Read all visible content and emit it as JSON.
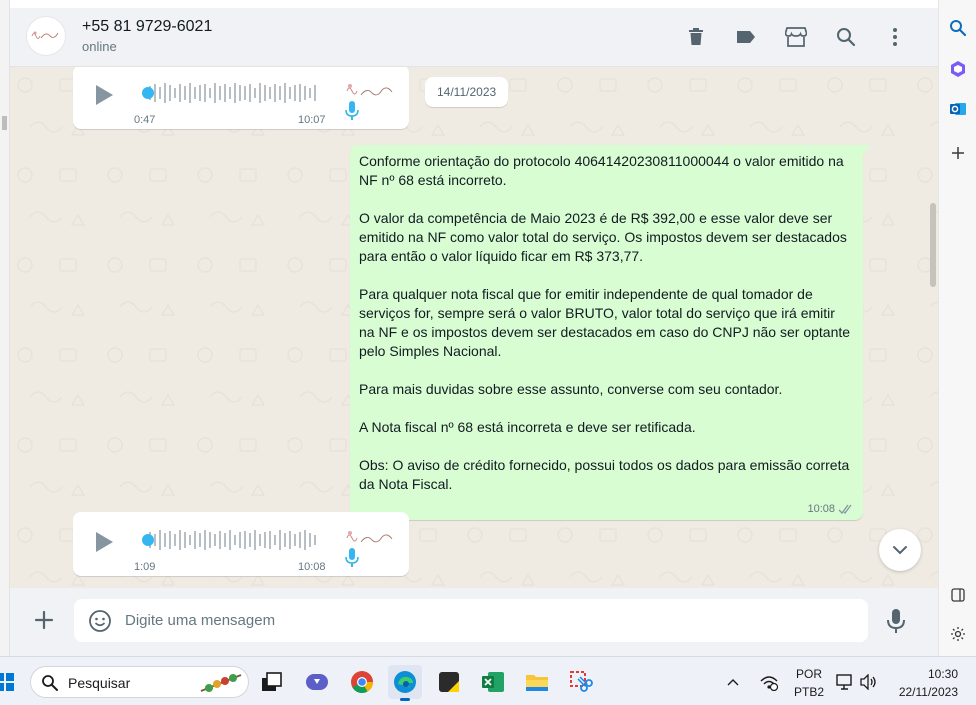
{
  "chat": {
    "contact_name": "+55 81 9729-6021",
    "status": "online"
  },
  "voice_notes": [
    {
      "duration": "0:47",
      "time": "10:07"
    },
    {
      "duration": "1:09",
      "time": "10:08"
    }
  ],
  "date_chip": "14/11/2023",
  "outgoing_message": {
    "paragraphs": [
      "Conforme orientação do protocolo 40641420230811000044 o valor emitido na NF nº 68 está incorreto.",
      "O valor da competência de Maio 2023 é de R$ 392,00 e esse valor deve ser emitido na NF como valor total do serviço. Os impostos devem ser destacados para então o valor líquido ficar em R$ 373,77.",
      "Para qualquer nota fiscal que for emitir independente de qual tomador de serviços for, sempre será o valor BRUTO, valor total do serviço que irá emitir na NF e os impostos devem ser destacados em caso do CNPJ não ser optante pelo Simples Nacional.",
      "Para mais duvidas sobre esse assunto, converse com seu contador.",
      "A Nota fiscal nº 68 está incorreta e deve ser retificada.",
      "Obs: O aviso de crédito fornecido, possui todos os dados para emissão correta da Nota Fiscal."
    ],
    "time": "10:08"
  },
  "composer": {
    "placeholder": "Digite uma mensagem"
  },
  "taskbar": {
    "search_label": "Pesquisar",
    "lang_top": "POR",
    "lang_bottom": "PTB2",
    "clock_time": "10:30",
    "clock_date": "22/11/2023"
  },
  "colors": {
    "outgoing_bubble": "#d9fdd3",
    "chat_background": "#efeae2",
    "header_background": "#f0f2f5",
    "play_button": "#8696a0",
    "voice_progress": "#34b7f1",
    "read_ticks": "#8696a0"
  },
  "icons": {
    "header": [
      "delete-icon",
      "label-icon",
      "store-icon",
      "search-icon",
      "menu-icon"
    ],
    "edge_sidebar": [
      "edge-search-icon",
      "copilot-icon",
      "outlook-icon",
      "add-icon",
      "sidebar-toggle-icon",
      "settings-icon"
    ],
    "taskbar_apps": [
      "start-icon",
      "search-icon",
      "task-view-icon",
      "teams-icon",
      "chrome-icon",
      "edge-icon",
      "app-icon",
      "excel-icon",
      "file-explorer-icon",
      "snipping-tool-icon"
    ],
    "tray": [
      "chevron-up-icon",
      "network-icon",
      "speaker-icon"
    ]
  }
}
